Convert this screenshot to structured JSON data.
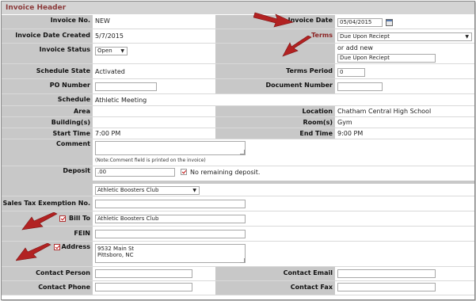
{
  "header": {
    "title": "Invoice Header"
  },
  "invoice_no": {
    "label": "Invoice No.",
    "value": "NEW"
  },
  "invoice_date": {
    "label": "Invoice Date",
    "value": "05/04/2015"
  },
  "invoice_date_created": {
    "label": "Invoice Date Created",
    "value": "5/7/2015"
  },
  "terms": {
    "label": "Terms",
    "selected": "Due Upon Reciept",
    "or_add_new": "or add new",
    "add_new_value": "Due Upon Reciept"
  },
  "invoice_status": {
    "label": "Invoice Status",
    "selected": "Open"
  },
  "schedule_state": {
    "label": "Schedule State",
    "value": "Activated"
  },
  "terms_period": {
    "label": "Terms Period",
    "value": "0"
  },
  "po_number": {
    "label": "PO Number",
    "value": ""
  },
  "document_number": {
    "label": "Document Number",
    "value": ""
  },
  "schedule": {
    "label": "Schedule",
    "value": "Athletic Meeting"
  },
  "area": {
    "label": "Area",
    "value": ""
  },
  "location": {
    "label": "Location",
    "value": "Chatham Central High School"
  },
  "buildings": {
    "label": "Building(s)",
    "value": ""
  },
  "rooms": {
    "label": "Room(s)",
    "value": "Gym"
  },
  "start_time": {
    "label": "Start Time",
    "value": "7:00 PM"
  },
  "end_time": {
    "label": "End Time",
    "value": "9:00 PM"
  },
  "comment": {
    "label": "Comment",
    "value": "",
    "note": "(Note:Comment field is printed on the invoice)"
  },
  "deposit": {
    "label": "Deposit",
    "value": ".00",
    "no_remaining": "No remaining deposit."
  },
  "customer": {
    "selected": "Athletic Boosters Club"
  },
  "sales_tax": {
    "label": "Sales Tax Exemption No.",
    "value": ""
  },
  "bill_to": {
    "label": "Bill To",
    "value": "Athletic Boosters Club"
  },
  "fein": {
    "label": "FEIN",
    "value": ""
  },
  "address": {
    "label": "Address",
    "line1": "9532 Main St",
    "line2": "Pittsboro, NC"
  },
  "contact_person": {
    "label": "Contact Person",
    "value": ""
  },
  "contact_email": {
    "label": "Contact Email",
    "value": ""
  },
  "contact_phone": {
    "label": "Contact Phone",
    "value": ""
  },
  "contact_fax": {
    "label": "Contact Fax",
    "value": ""
  },
  "colors": {
    "label_bg": "#c8c8c8",
    "title": "#8b3a3a",
    "arrow": "#b22222"
  },
  "icons": [
    "calendar-icon",
    "chevron-down-icon",
    "checkbox-checked-icon",
    "red-arrow-icon",
    "resize-grip-icon"
  ]
}
